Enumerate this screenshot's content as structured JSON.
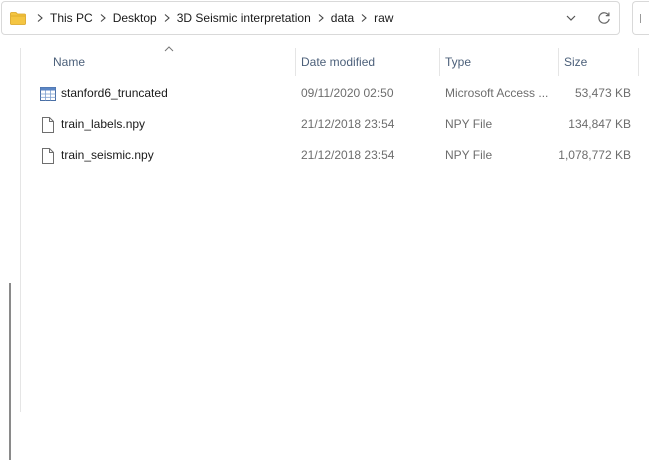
{
  "address_bar": {
    "breadcrumbs": [
      "This PC",
      "Desktop",
      "3D Seismic interpretation",
      "data",
      "raw"
    ]
  },
  "columns": {
    "name": "Name",
    "date_modified": "Date modified",
    "type": "Type",
    "size": "Size"
  },
  "files": [
    {
      "name": "stanford6_truncated",
      "date_modified": "09/11/2020 02:50",
      "type": "Microsoft Access ...",
      "size": "53,473 KB",
      "icon": "database-table-icon"
    },
    {
      "name": "train_labels.npy",
      "date_modified": "21/12/2018 23:54",
      "type": "NPY File",
      "size": "134,847 KB",
      "icon": "file-icon"
    },
    {
      "name": "train_seismic.npy",
      "date_modified": "21/12/2018 23:54",
      "type": "NPY File",
      "size": "1,078,772 KB",
      "icon": "file-icon"
    }
  ],
  "colors": {
    "folder": "#f4c542",
    "header_text": "#4c607a",
    "border": "#d9d9d9"
  }
}
